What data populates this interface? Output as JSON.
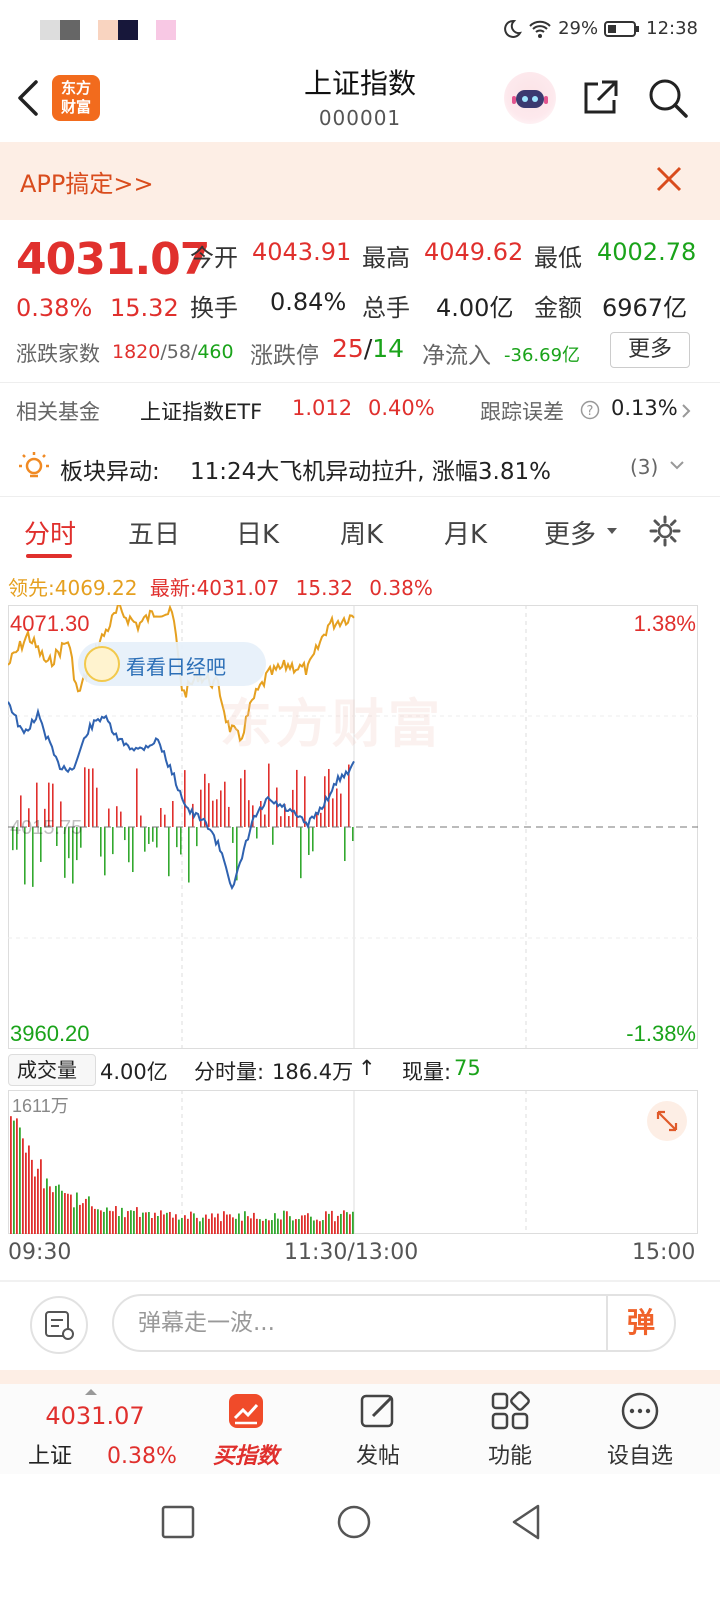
{
  "status_bar": {
    "battery": "29%",
    "time": "12:38"
  },
  "header": {
    "title": "上证指数",
    "code": "000001",
    "logo_line1": "东方",
    "logo_line2": "财富"
  },
  "banner": {
    "text": "APP搞定>>"
  },
  "quote": {
    "price": "4031.07",
    "change_pct": "0.38%",
    "change": "15.32",
    "open_label": "今开",
    "open": "4043.91",
    "high_label": "最高",
    "high": "4049.62",
    "low_label": "最低",
    "low": "4002.78",
    "turnover_label": "换手",
    "turnover": "0.84%",
    "volume_label": "总手",
    "volume": "4.00亿",
    "amount_label": "金额",
    "amount": "6967亿",
    "breadth_label": "涨跌家数",
    "breadth_up": "1820",
    "breadth_flat": "/58/",
    "breadth_down": "460",
    "limit_label": "涨跌停",
    "limit_up": "25",
    "limit_slash": "/",
    "limit_down": "14",
    "netflow_label": "净流入",
    "netflow": "-36.69亿",
    "more_button": "更多"
  },
  "fund": {
    "label": "相关基金",
    "name": "上证指数ETF",
    "price": "1.012",
    "pct": "0.40%",
    "track_label": "跟踪误差",
    "track_value": "0.13%"
  },
  "alert": {
    "title": "板块异动:",
    "text": "11:24大飞机异动拉升, 涨幅3.81%",
    "count": "(3)"
  },
  "tabs": [
    "分时",
    "五日",
    "日K",
    "周K",
    "月K",
    "更多"
  ],
  "info_line": {
    "leader_label": "领先:",
    "leader_value": "4069.22",
    "latest_label": "最新:",
    "latest_value": "4031.07",
    "change": "15.32",
    "pct": "0.38%"
  },
  "chart_data": {
    "type": "line",
    "y_top": "4071.30",
    "y_bottom": "3960.20",
    "y_mid": "4015.75",
    "pct_top": "1.38%",
    "pct_bottom": "-1.38%",
    "bubble_text": "看看日经吧",
    "watermark": "东方财富",
    "series": [
      {
        "name": "领先",
        "color": "#e5a020"
      },
      {
        "name": "最新",
        "color": "#2f62b0"
      }
    ]
  },
  "volume": {
    "select_label": "成交量",
    "total": "4.00亿",
    "tick_label": "分时量:",
    "tick_value": "186.4万",
    "arrow": "↑",
    "now_label": "现量:",
    "now_value": "75",
    "max_label": "1611万"
  },
  "time_axis": {
    "start": "09:30",
    "mid": "11:30/13:00",
    "end": "15:00"
  },
  "danmaku": {
    "placeholder": "弹幕走一波...",
    "send": "弹"
  },
  "bottom_nav": {
    "index_price": "4031.07",
    "index_name": "上证",
    "index_pct": "0.38%",
    "buy": "买指数",
    "post": "发帖",
    "func": "功能",
    "watch": "设自选"
  }
}
